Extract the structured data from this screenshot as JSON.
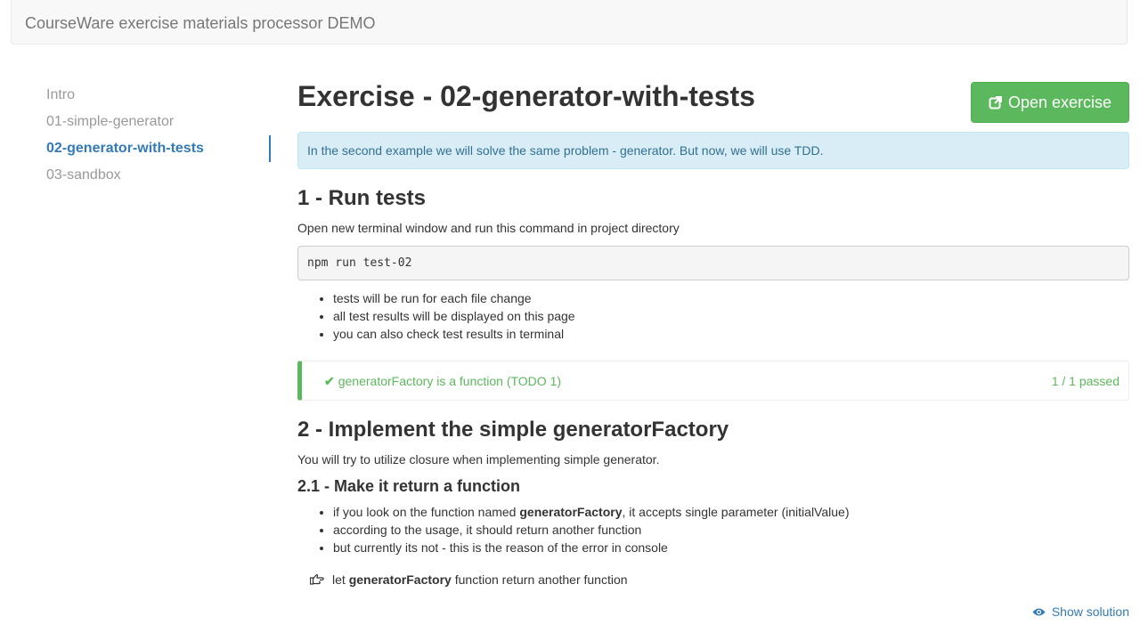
{
  "navbar": {
    "brand": "CourseWare exercise materials processor DEMO"
  },
  "sidebar": {
    "items": [
      {
        "label": "Intro",
        "active": false
      },
      {
        "label": "01-simple-generator",
        "active": false
      },
      {
        "label": "02-generator-with-tests",
        "active": true
      },
      {
        "label": "03-sandbox",
        "active": false
      }
    ]
  },
  "main": {
    "title": "Exercise - 02-generator-with-tests",
    "open_button": {
      "label": "Open exercise",
      "icon": "external-link-icon"
    },
    "alert": "In the second example we will solve the same problem - generator. But now, we will use TDD.",
    "section1": {
      "heading": "1 - Run tests",
      "intro": "Open new terminal window and run this command in project directory",
      "command": "npm run test-02",
      "bullets": [
        "tests will be run for each file change",
        "all test results will be displayed on this page",
        "you can also check test results in terminal"
      ]
    },
    "test_result": {
      "icon": "checkmark-icon",
      "name": "generatorFactory is a function (TODO 1)",
      "count": "1 / 1 passed",
      "color": "#5cb85c"
    },
    "section2": {
      "heading": "2 - Implement the simple generatorFactory",
      "intro": "You will try to utilize closure when implementing simple generator.",
      "subheading": "2.1 - Make it return a function",
      "bullets": [
        {
          "pre": "if you look on the function named ",
          "bold": "generatorFactory",
          "post": ", it accepts single parameter (initialValue)"
        },
        {
          "pre": "according to the usage, it should return another function"
        },
        {
          "pre": "but currently its not - this is the reason of the error in console"
        }
      ],
      "hint": {
        "icon": "hand-pointing-icon",
        "pre": "let ",
        "bold": "generatorFactory",
        "post": " function return another function"
      }
    },
    "show_solution": {
      "label": "Show solution",
      "icon": "eye-icon"
    }
  },
  "colors": {
    "accent": "#337ab7",
    "success": "#5cb85c",
    "info_bg": "#d9edf7",
    "info_text": "#31708f"
  }
}
